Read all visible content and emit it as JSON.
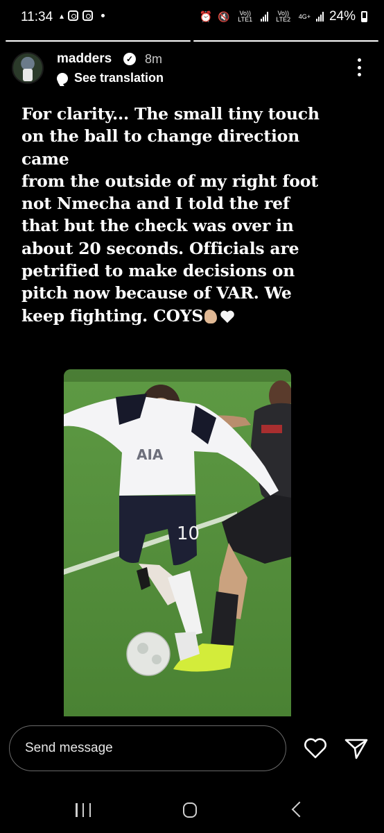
{
  "status_bar": {
    "time": "11:34",
    "network1": "Vo)) LTE1",
    "network2": "Vo)) LTE2",
    "network_type": "4G+",
    "battery": "24%",
    "icons": [
      "data-saver-icon",
      "instagram-icon",
      "instagram-icon",
      "notification-dot",
      "alarm-icon",
      "mute-icon",
      "signal-icon",
      "battery-icon"
    ]
  },
  "story": {
    "progress_segments": 2,
    "progress_current": 1,
    "username": "madders",
    "verified": true,
    "time_ago": "8m",
    "translation_link": "See translation",
    "caption": "For clarity... The small tiny touch\non the ball to change direction\ncame\nfrom the outside of my right foot\nnot Nmecha and I told the ref\nthat but the check was over in\nabout 20 seconds. Officials are\npetrified to make decisions on\npitch now because of VAR. We\nkeep fighting. COYS",
    "caption_emojis": [
      "flexed-biceps-icon",
      "white-heart-icon"
    ],
    "photo": {
      "description_icon": "football-photo",
      "shirt_number": "10"
    }
  },
  "message_bar": {
    "placeholder": "Send message",
    "icons": [
      "heart-icon",
      "send-icon"
    ]
  },
  "nav_bar": {
    "icons": [
      "recent-apps-icon",
      "home-icon",
      "back-icon"
    ]
  },
  "colors": {
    "background": "#000000",
    "text": "#ffffff",
    "pitch": "#4f8a3a",
    "ball_boot": "#d8f03a"
  }
}
